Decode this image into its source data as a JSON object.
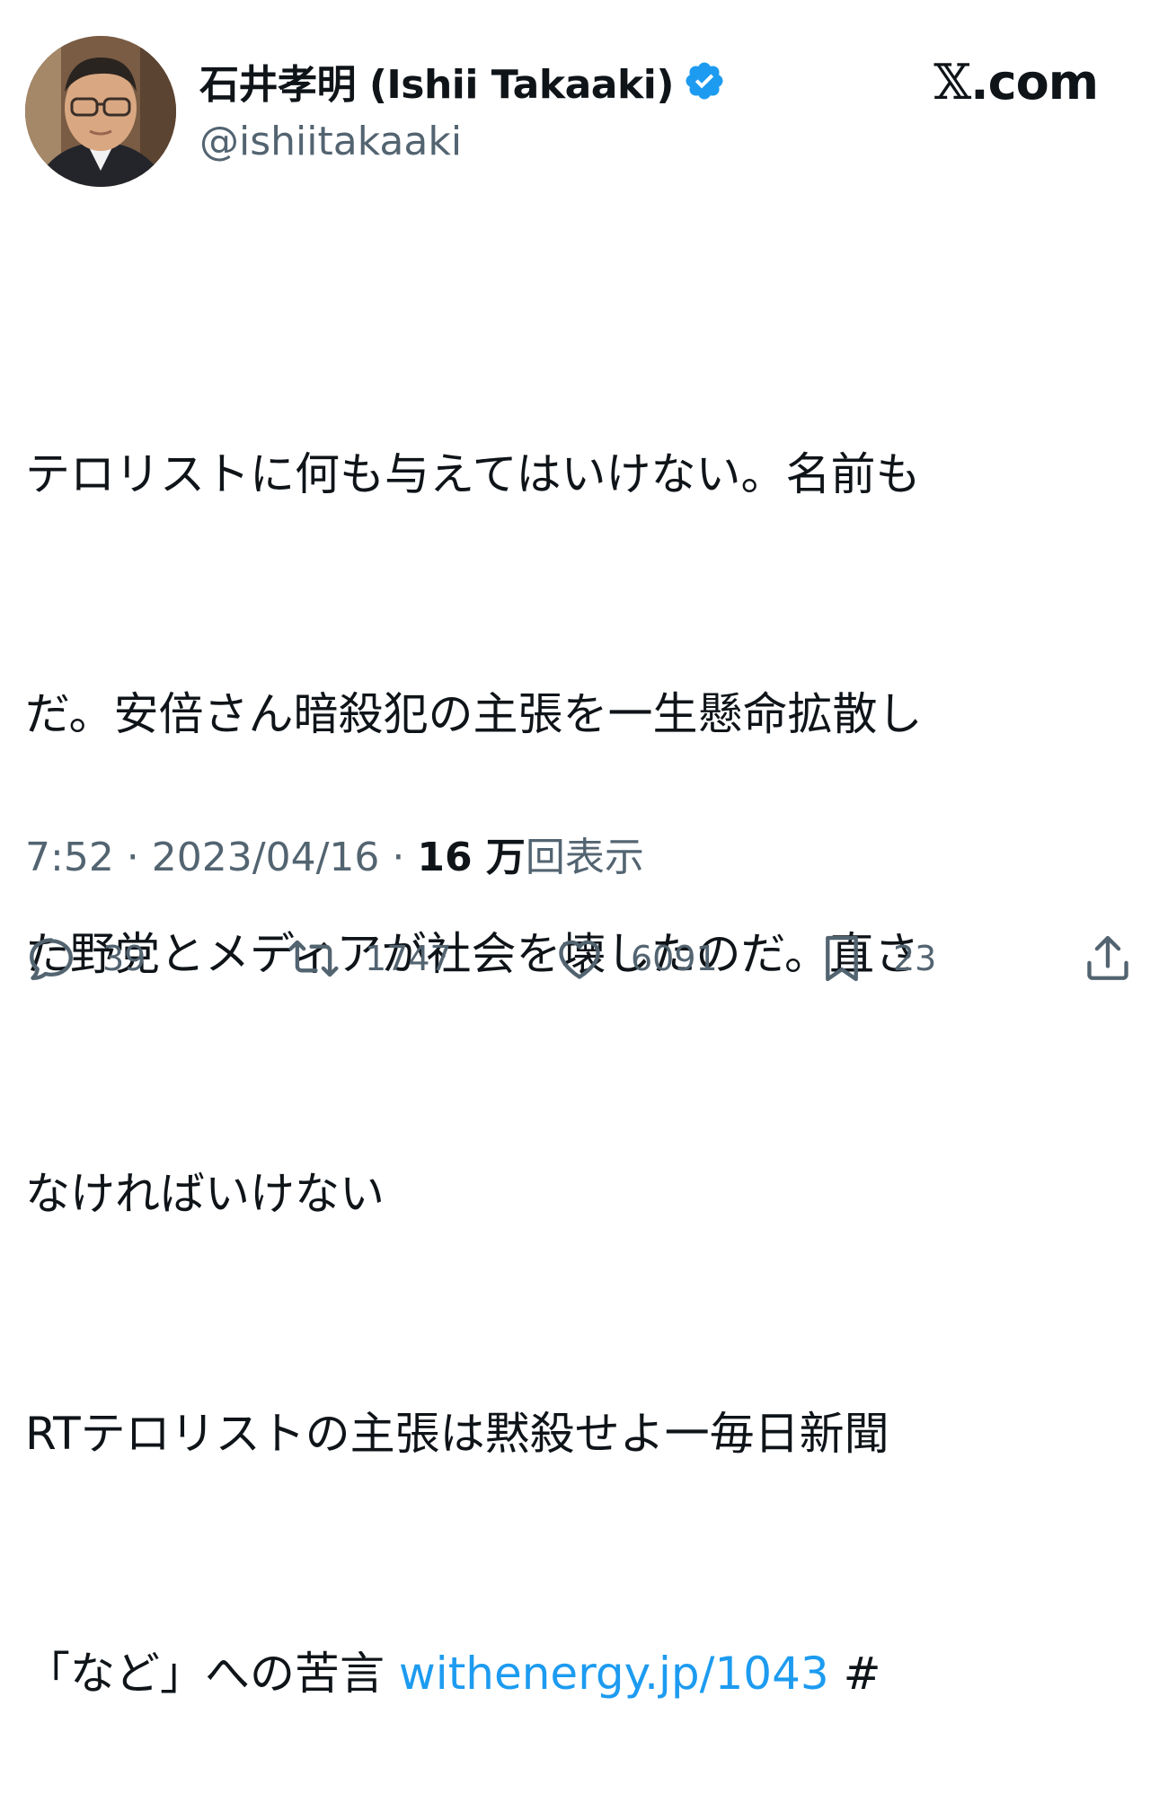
{
  "author": {
    "display_name": "石井孝明 (Ishii Takaaki)",
    "handle": "@ishiitakaaki",
    "verified_icon": "verified-badge-icon"
  },
  "site_label": ".com",
  "site_x": "𝕏",
  "tweet": {
    "lines": [
      "テロリストに何も与えてはいけない。名前も",
      "だ。安倍さん暗殺犯の主張を一生懸命拡散し",
      "た野党とメディアが社会を壊したのだ。直さ",
      "なければいけない",
      "RTテロリストの主張は黙殺せよ一毎日新聞"
    ],
    "last_line_prefix": "「など」への苦言 ",
    "link_text": "withenergy.jp/1043",
    "last_line_suffix": " #"
  },
  "meta": {
    "time": "7:52",
    "separator": " · ",
    "date": "2023/04/16",
    "views_number": "16 万",
    "views_label": "回表示"
  },
  "actions": {
    "replies": "39",
    "retweets": "1747",
    "likes": "6091",
    "bookmarks": "23"
  },
  "colors": {
    "link": "#1d9bf0",
    "secondary_text": "#536471",
    "verified": "#1d9bf0"
  }
}
